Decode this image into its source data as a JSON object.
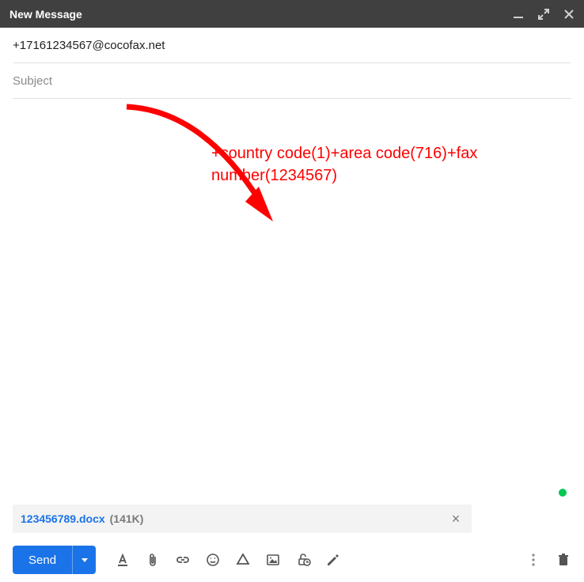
{
  "header": {
    "title": "New Message"
  },
  "fields": {
    "to": "+17161234567@cocofax.net",
    "subject_placeholder": "Subject"
  },
  "annotation": {
    "text": "+country code(1)+area code(716)+fax number(1234567)",
    "color": "#ff0000"
  },
  "attachment": {
    "name": "123456789.docx",
    "size": "(141K)"
  },
  "toolbar": {
    "send_label": "Send"
  },
  "icons": {
    "minimize": "minimize-icon",
    "expand": "expand-icon",
    "close": "close-icon",
    "format": "format-text-icon",
    "attach": "attach-file-icon",
    "link": "insert-link-icon",
    "emoji": "emoji-icon",
    "drive": "drive-icon",
    "photo": "insert-photo-icon",
    "confidential": "confidential-icon",
    "pen": "signature-icon",
    "more": "more-options-icon",
    "trash": "discard-draft-icon"
  }
}
